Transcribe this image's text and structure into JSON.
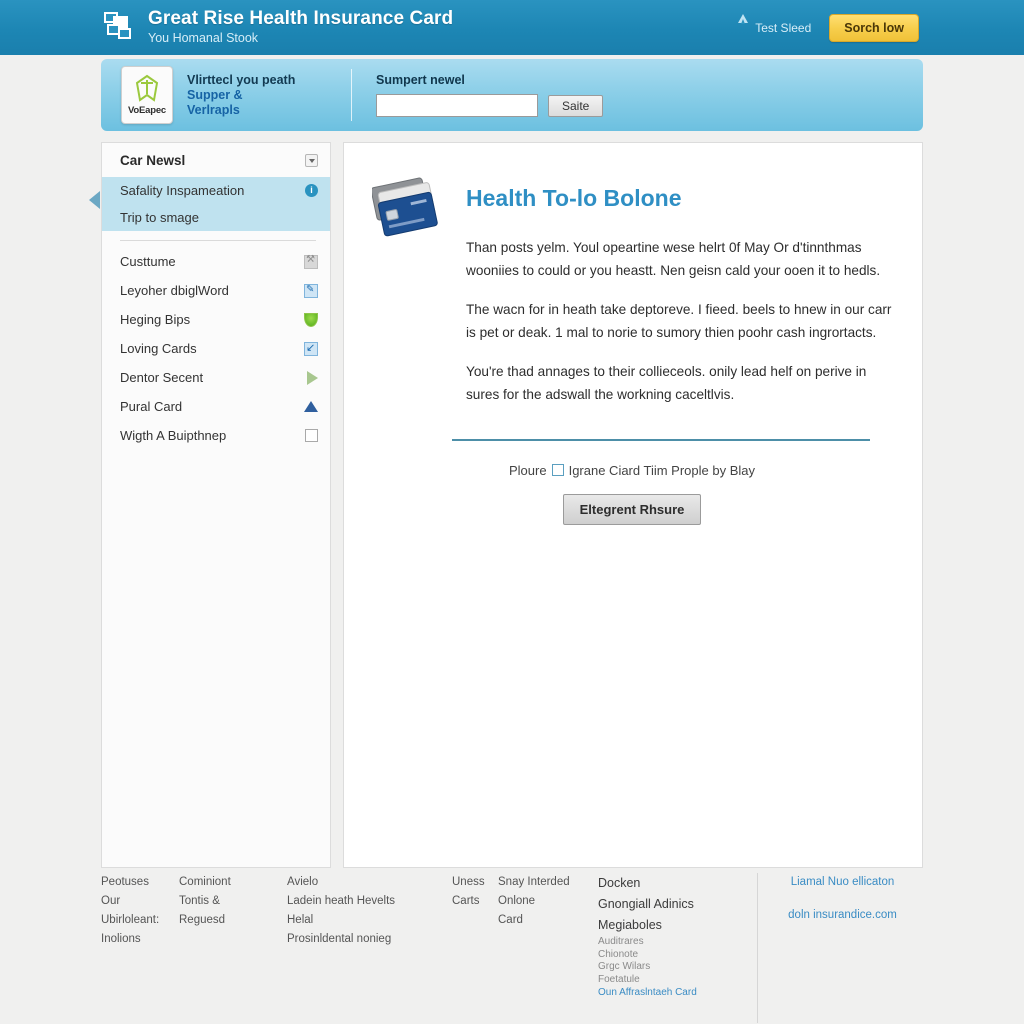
{
  "header": {
    "brand_title": "Great Rise Health Insurance Card",
    "brand_subtitle": "You Homanal Stook",
    "logo_icon": "card-stack-logo",
    "link_label": "Test Sleed",
    "link_icon": "triangle-alert-icon",
    "button_label": "Sorch low",
    "accent_color": "#1d86b4",
    "button_color": "#f7cf4d"
  },
  "banner": {
    "badge_icon": "green-ribbon-badge-icon",
    "badge_label": "VoEapec",
    "left_line1": "Vlirttecl you peath",
    "left_line2": "Supper &",
    "left_line3": "Verlrapls",
    "search_label": "Sumpert newel",
    "search_value": "",
    "search_placeholder": "",
    "search_button": "Saite"
  },
  "sidebar": {
    "title": "Car Newsl",
    "caret_icon": "chevron-down-icon",
    "collapse_icon": "arrow-left-icon",
    "active_items": [
      {
        "label": "Safality Inspameation",
        "icon": "info-circle-icon"
      },
      {
        "label": "Trip to smage",
        "icon": ""
      }
    ],
    "items": [
      {
        "label": "Custtume",
        "icon": "tool-icon"
      },
      {
        "label": "Leyoher dbiglWord",
        "icon": "pencil-icon"
      },
      {
        "label": "Heging Bips",
        "icon": "leaf-icon"
      },
      {
        "label": "Loving Cards",
        "icon": "arrow-diagonal-icon"
      },
      {
        "label": "Dentor Secent",
        "icon": "play-triangle-icon"
      },
      {
        "label": "Pural Card",
        "icon": "triangle-up-icon"
      },
      {
        "label": "Wigth A Buipthnep",
        "icon": "checkbox-icon"
      }
    ]
  },
  "main": {
    "hero_icon": "credit-cards-stack-icon",
    "title": "Health To-lo Bolone",
    "paragraphs": [
      "Than posts yelm. Youl opeartine wese helrt 0f May Or d'tinnthmas wooniies to could or you heastt. Nen geisn cald your ooen it to hedls.",
      "The wacn for in heath take deptoreve. I fieed. beels to hnew in our carr is pet or deak. 1 mal to norie to sumory thien poohr cash ingrortacts.",
      "You're thad annages to their collieceols. onily lead helf on perive in sures for the adswall the workning caceltlvis."
    ],
    "optin_prefix": "Ploure",
    "optin_checkbox": "consent-checkbox",
    "optin_text": "Igrane Ciard Tiim Prople by Blay",
    "cta_label": "Eltegrent Rhsure"
  },
  "footer": {
    "col1": [
      "Peotuses",
      "Our",
      "Ubirloleant:",
      "Inolions"
    ],
    "col2": [
      "Cominiont",
      "Tontis &",
      "Reguesd"
    ],
    "col3": [
      "Avielo",
      "Ladein heath Hevelts",
      "Helal",
      "Prosinldental nonieg"
    ],
    "col4": [
      "Uness",
      "Carts"
    ],
    "col5": [
      "Snay Interded",
      "Onlone",
      "Card"
    ],
    "col6_big": [
      "Docken",
      "Gnongiall Adinics",
      "Megiaboles"
    ],
    "col6_small": [
      "Auditrares",
      "Chionote",
      "Grgc Wilars",
      "Foetatule"
    ],
    "col6_link": "Oun Affraslntaeh Card",
    "col7_top": "Liamal Nuo ellicaton",
    "col7_bottom": "doln insurandice.com"
  }
}
